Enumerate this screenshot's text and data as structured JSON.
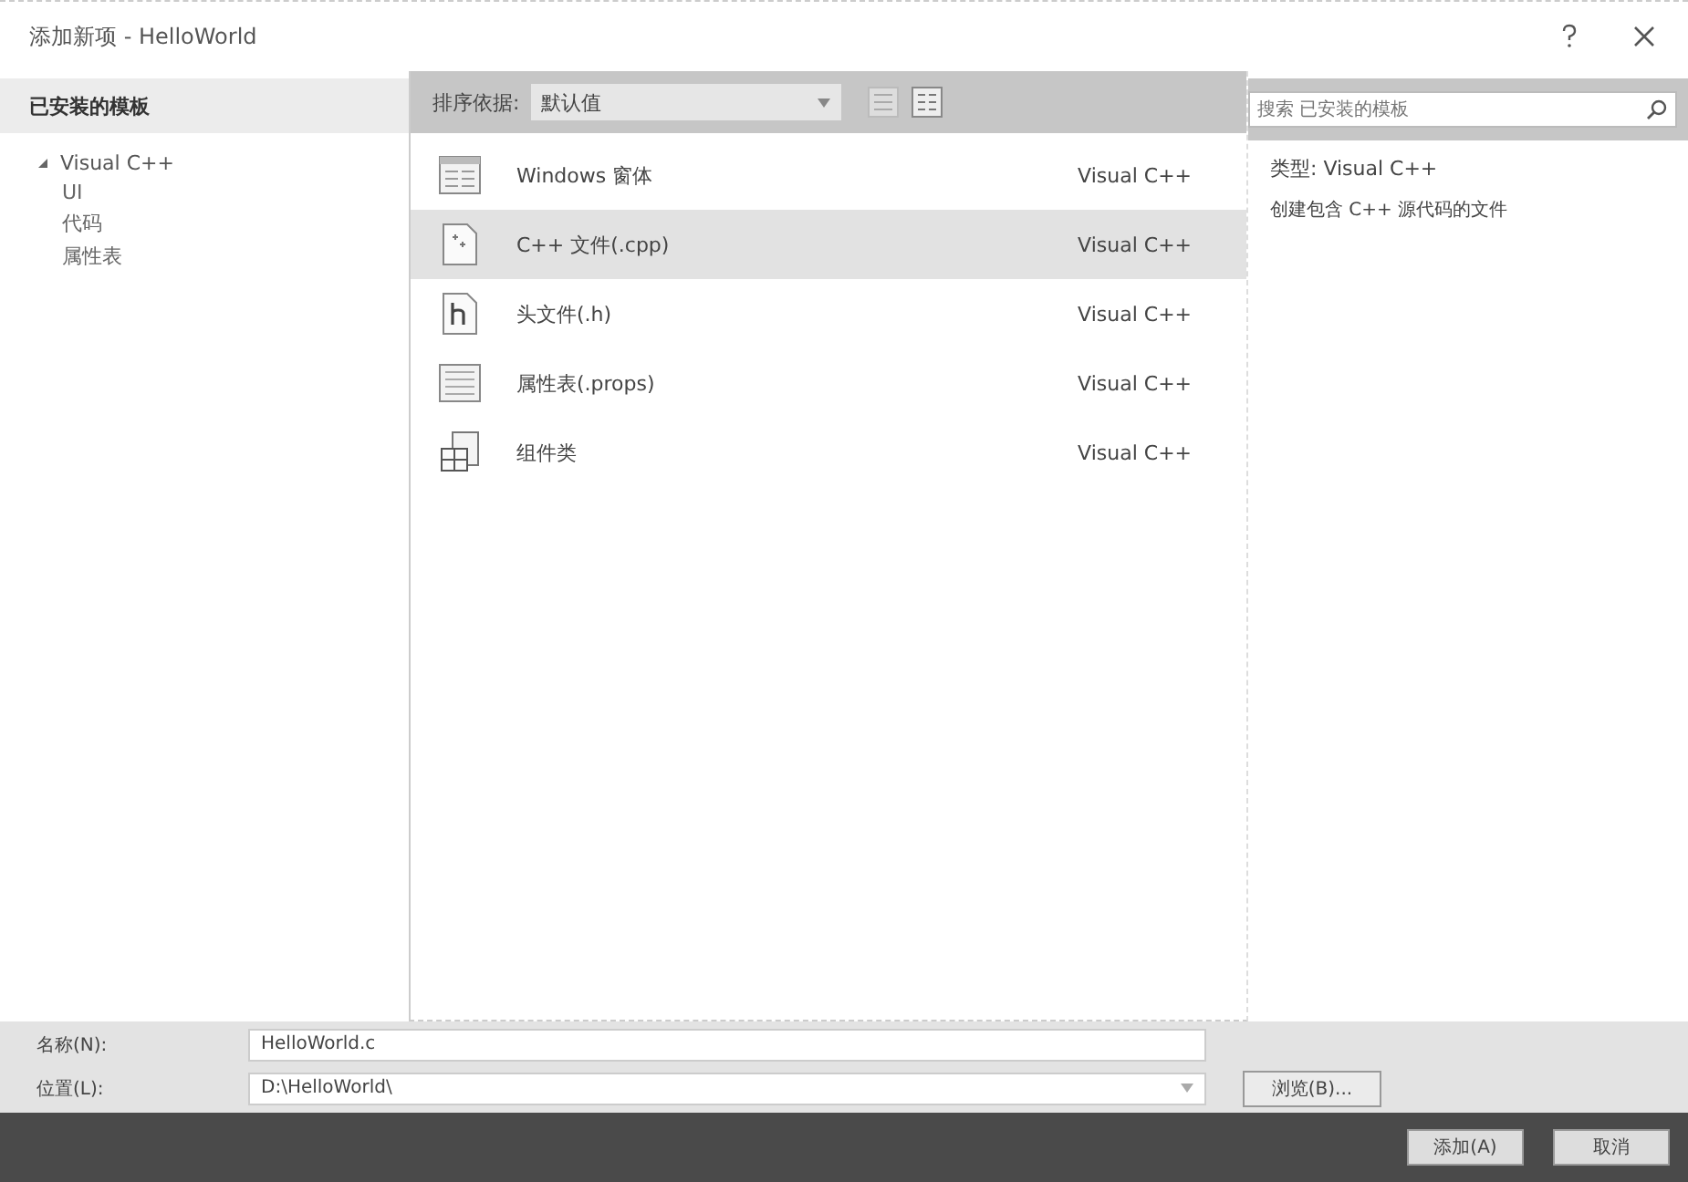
{
  "window": {
    "title": "添加新项 - HelloWorld"
  },
  "sidebar": {
    "title": "已安装的模板",
    "tree": [
      {
        "label": "Visual C++",
        "expanded": true,
        "children": [
          {
            "label": "UI"
          },
          {
            "label": "代码"
          },
          {
            "label": "属性表"
          }
        ]
      }
    ]
  },
  "toolbar": {
    "sort_label": "排序依据:",
    "sort_value": "默认值"
  },
  "search": {
    "placeholder": "搜索 已安装的模板"
  },
  "templates": [
    {
      "kind": "form",
      "name": "Windows 窗体",
      "type": "Visual C++",
      "selected": false
    },
    {
      "kind": "cpp",
      "name": "C++ 文件(.cpp)",
      "type": "Visual C++",
      "selected": true
    },
    {
      "kind": "header",
      "name": "头文件(.h)",
      "type": "Visual C++",
      "selected": false
    },
    {
      "kind": "props",
      "name": "属性表(.props)",
      "type": "Visual C++",
      "selected": false
    },
    {
      "kind": "component",
      "name": "组件类",
      "type": "Visual C++",
      "selected": false
    }
  ],
  "details": {
    "type_line": "类型: Visual C++",
    "description": "创建包含 C++ 源代码的文件"
  },
  "name_field": {
    "label": "名称(N):",
    "value": "HelloWorld.c"
  },
  "location_field": {
    "label": "位置(L):",
    "value": "D:\\HelloWorld\\"
  },
  "buttons": {
    "browse": "浏览(B)...",
    "add": "添加(A)",
    "cancel": "取消"
  }
}
